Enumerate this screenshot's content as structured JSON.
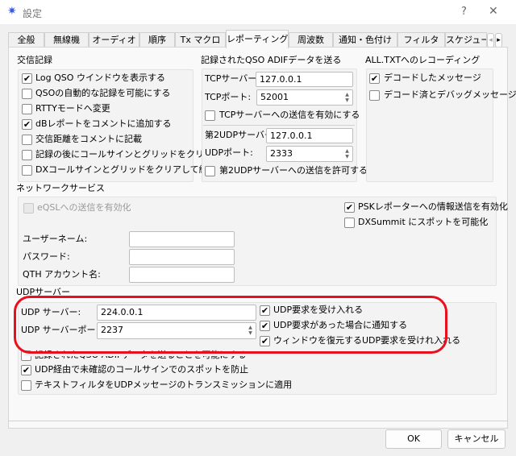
{
  "window": {
    "title": "設定",
    "help": "?",
    "close": "✕"
  },
  "tabs": [
    "全般",
    "無線機",
    "オーディオ",
    "順序",
    "Tx マクロ",
    "レポーティング",
    "周波数",
    "通知・色付け",
    "フィルタ",
    "スケジュー"
  ],
  "tab_arrows": {
    "left": "◂",
    "right": "▸"
  },
  "logging": {
    "title": "交信記録",
    "items": [
      {
        "label": "Log QSO ウインドウを表示する",
        "checked": true
      },
      {
        "label": "QSOの自動的な記録を可能にする",
        "checked": false
      },
      {
        "label": "RTTYモードへ変更",
        "checked": false
      },
      {
        "label": "dBレポートをコメントに追加する",
        "checked": true
      },
      {
        "label": "交信距離をコメントに記載",
        "checked": false
      },
      {
        "label": "記録の後にコールサインとグリッドをクリアする",
        "checked": false
      },
      {
        "label": "DXコールサインとグリッドをクリアして終了",
        "checked": false
      }
    ]
  },
  "adif": {
    "title": "記録されたQSO ADIFデータを送る",
    "tcp_server_label": "TCPサーバー:",
    "tcp_server": "127.0.0.1",
    "tcp_port_label": "TCPポート:",
    "tcp_port": "52001",
    "tcp_enable": "TCPサーバーへの送信を有効にする",
    "udp2_server_label": "第2UDPサーバー",
    "udp2_server": "127.0.0.1",
    "udp_port_label": "UDPポート:",
    "udp_port": "2333",
    "udp2_enable": "第2UDPサーバーへの送信を許可する"
  },
  "alltxt": {
    "title": "ALL.TXTへのレコーディング",
    "items": [
      {
        "label": "デコードしたメッセージ",
        "checked": true
      },
      {
        "label": "デコード済とデバッグメッセージ",
        "checked": false
      }
    ]
  },
  "network": {
    "title": "ネットワークサービス",
    "eqsl": "eQSLへの送信を有効化",
    "psk": "PSKレポーターへの情報送信を有効化",
    "dxsummit": "DXSummit にスポットを可能化",
    "username_label": "ユーザーネーム:",
    "password_label": "パスワード:",
    "qth_label": "QTH アカウント名:",
    "username": "",
    "password": "",
    "qth": ""
  },
  "udp": {
    "title": "UDPサーバー",
    "server_label": "UDP サーバー:",
    "server": "224.0.0.1",
    "port_label": "UDP サーバーポート:",
    "port": "2237",
    "accept": "UDP要求を受け入れる",
    "notify": "UDP要求があった場合に通知する",
    "restore": "ウィンドウを復元するUDP要求を受けれ入れる",
    "send_adif": "記録されたQSO ADIFデータを送ることを可能にする",
    "prevent": "UDP経由で未確認のコールサインでのスポットを防止",
    "textfilter": "テキストフィルタをUDPメッセージのトランスミッションに適用"
  },
  "buttons": {
    "ok": "OK",
    "cancel": "キャンセル"
  },
  "check_mark": "✔",
  "colors": {
    "highlight": "#e8101e"
  }
}
